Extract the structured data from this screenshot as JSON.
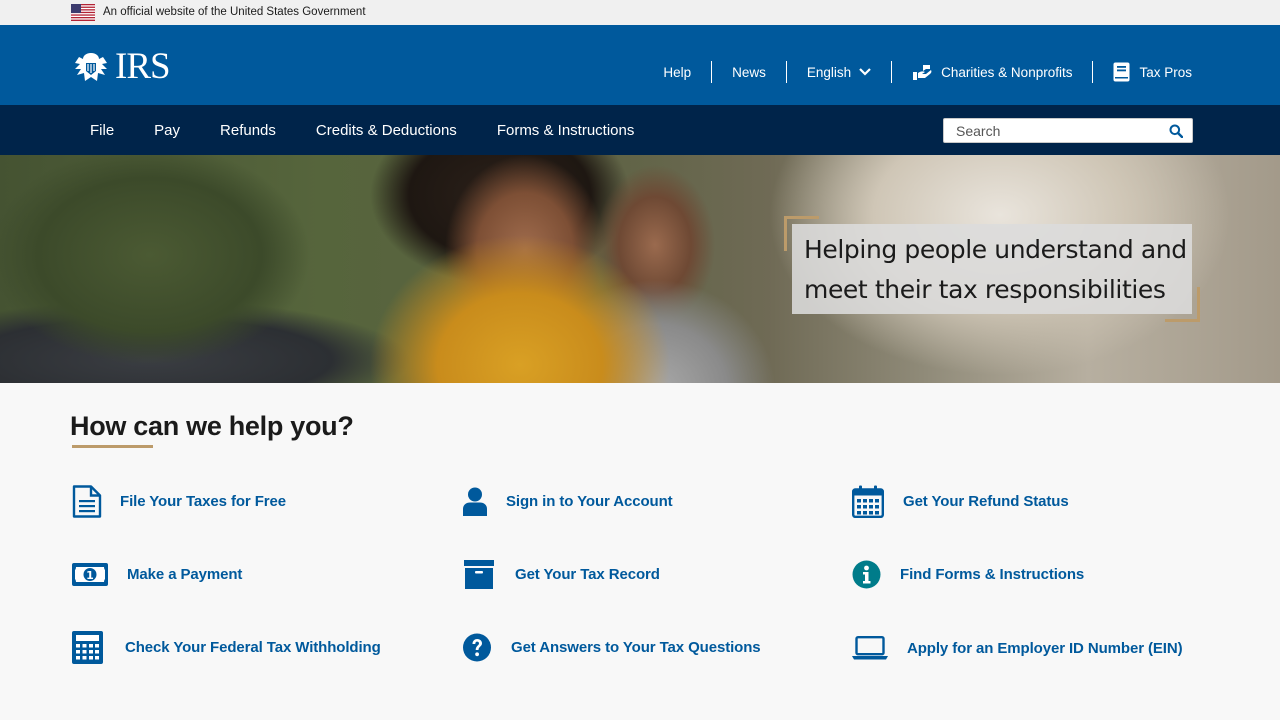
{
  "gov_banner": {
    "text": "An official website of the United States Government"
  },
  "header": {
    "logo_text": "IRS",
    "utility": [
      {
        "label": "Help"
      },
      {
        "label": "News"
      },
      {
        "label": "English"
      },
      {
        "label": "Charities & Nonprofits"
      },
      {
        "label": "Tax Pros"
      }
    ]
  },
  "nav": {
    "items": [
      {
        "label": "File"
      },
      {
        "label": "Pay"
      },
      {
        "label": "Refunds"
      },
      {
        "label": "Credits & Deductions"
      },
      {
        "label": "Forms & Instructions"
      }
    ],
    "search_placeholder": "Search"
  },
  "hero": {
    "headline": "Helping people understand and meet their tax responsibilities"
  },
  "help": {
    "title": "How can we help you?",
    "links": [
      {
        "label": "File Your Taxes for Free",
        "icon": "document-icon"
      },
      {
        "label": "Sign in to Your Account",
        "icon": "user-icon"
      },
      {
        "label": "Get Your Refund Status",
        "icon": "calendar-icon"
      },
      {
        "label": "Make a Payment",
        "icon": "money-icon"
      },
      {
        "label": "Get Your Tax Record",
        "icon": "archive-box-icon"
      },
      {
        "label": "Find Forms & Instructions",
        "icon": "info-icon"
      },
      {
        "label": "Check Your Federal Tax Withholding",
        "icon": "calculator-icon"
      },
      {
        "label": "Get Answers to Your Tax Questions",
        "icon": "question-icon"
      },
      {
        "label": "Apply for an Employer ID Number (EIN)",
        "icon": "laptop-icon"
      }
    ]
  },
  "colors": {
    "header_blue": "#00599c",
    "nav_navy": "#00244a",
    "link_blue": "#00599c",
    "accent_gold": "#bc9b6a",
    "info_teal": "#007c8a"
  }
}
